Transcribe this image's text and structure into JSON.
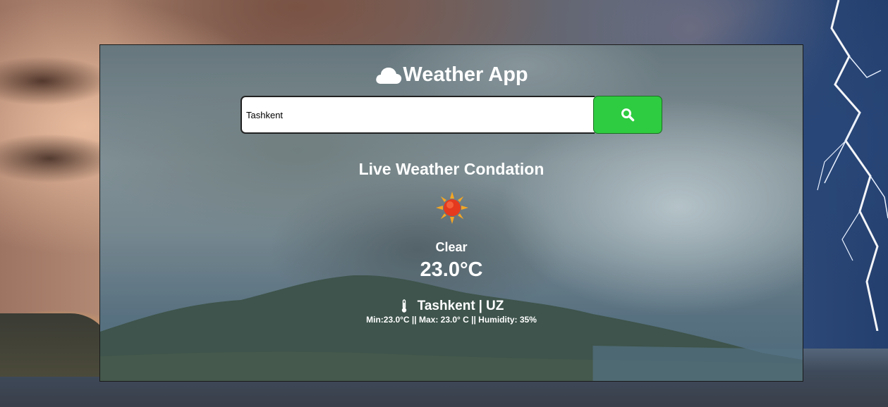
{
  "app": {
    "title": "Weather App",
    "title_icon": "cloud-icon"
  },
  "search": {
    "value": "Tashkent",
    "button_icon": "search-icon",
    "button_color": "#2ecc40"
  },
  "weather": {
    "heading": "Live Weather Condation",
    "icon": "sun-icon",
    "condition": "Clear",
    "temperature": "23.0°C",
    "city": "Tashkent",
    "separator": "|",
    "country": "UZ",
    "location_icon": "thermometer-icon",
    "details": "Min:23.0°C || Max: 23.0° C || Humidity: 35%"
  }
}
